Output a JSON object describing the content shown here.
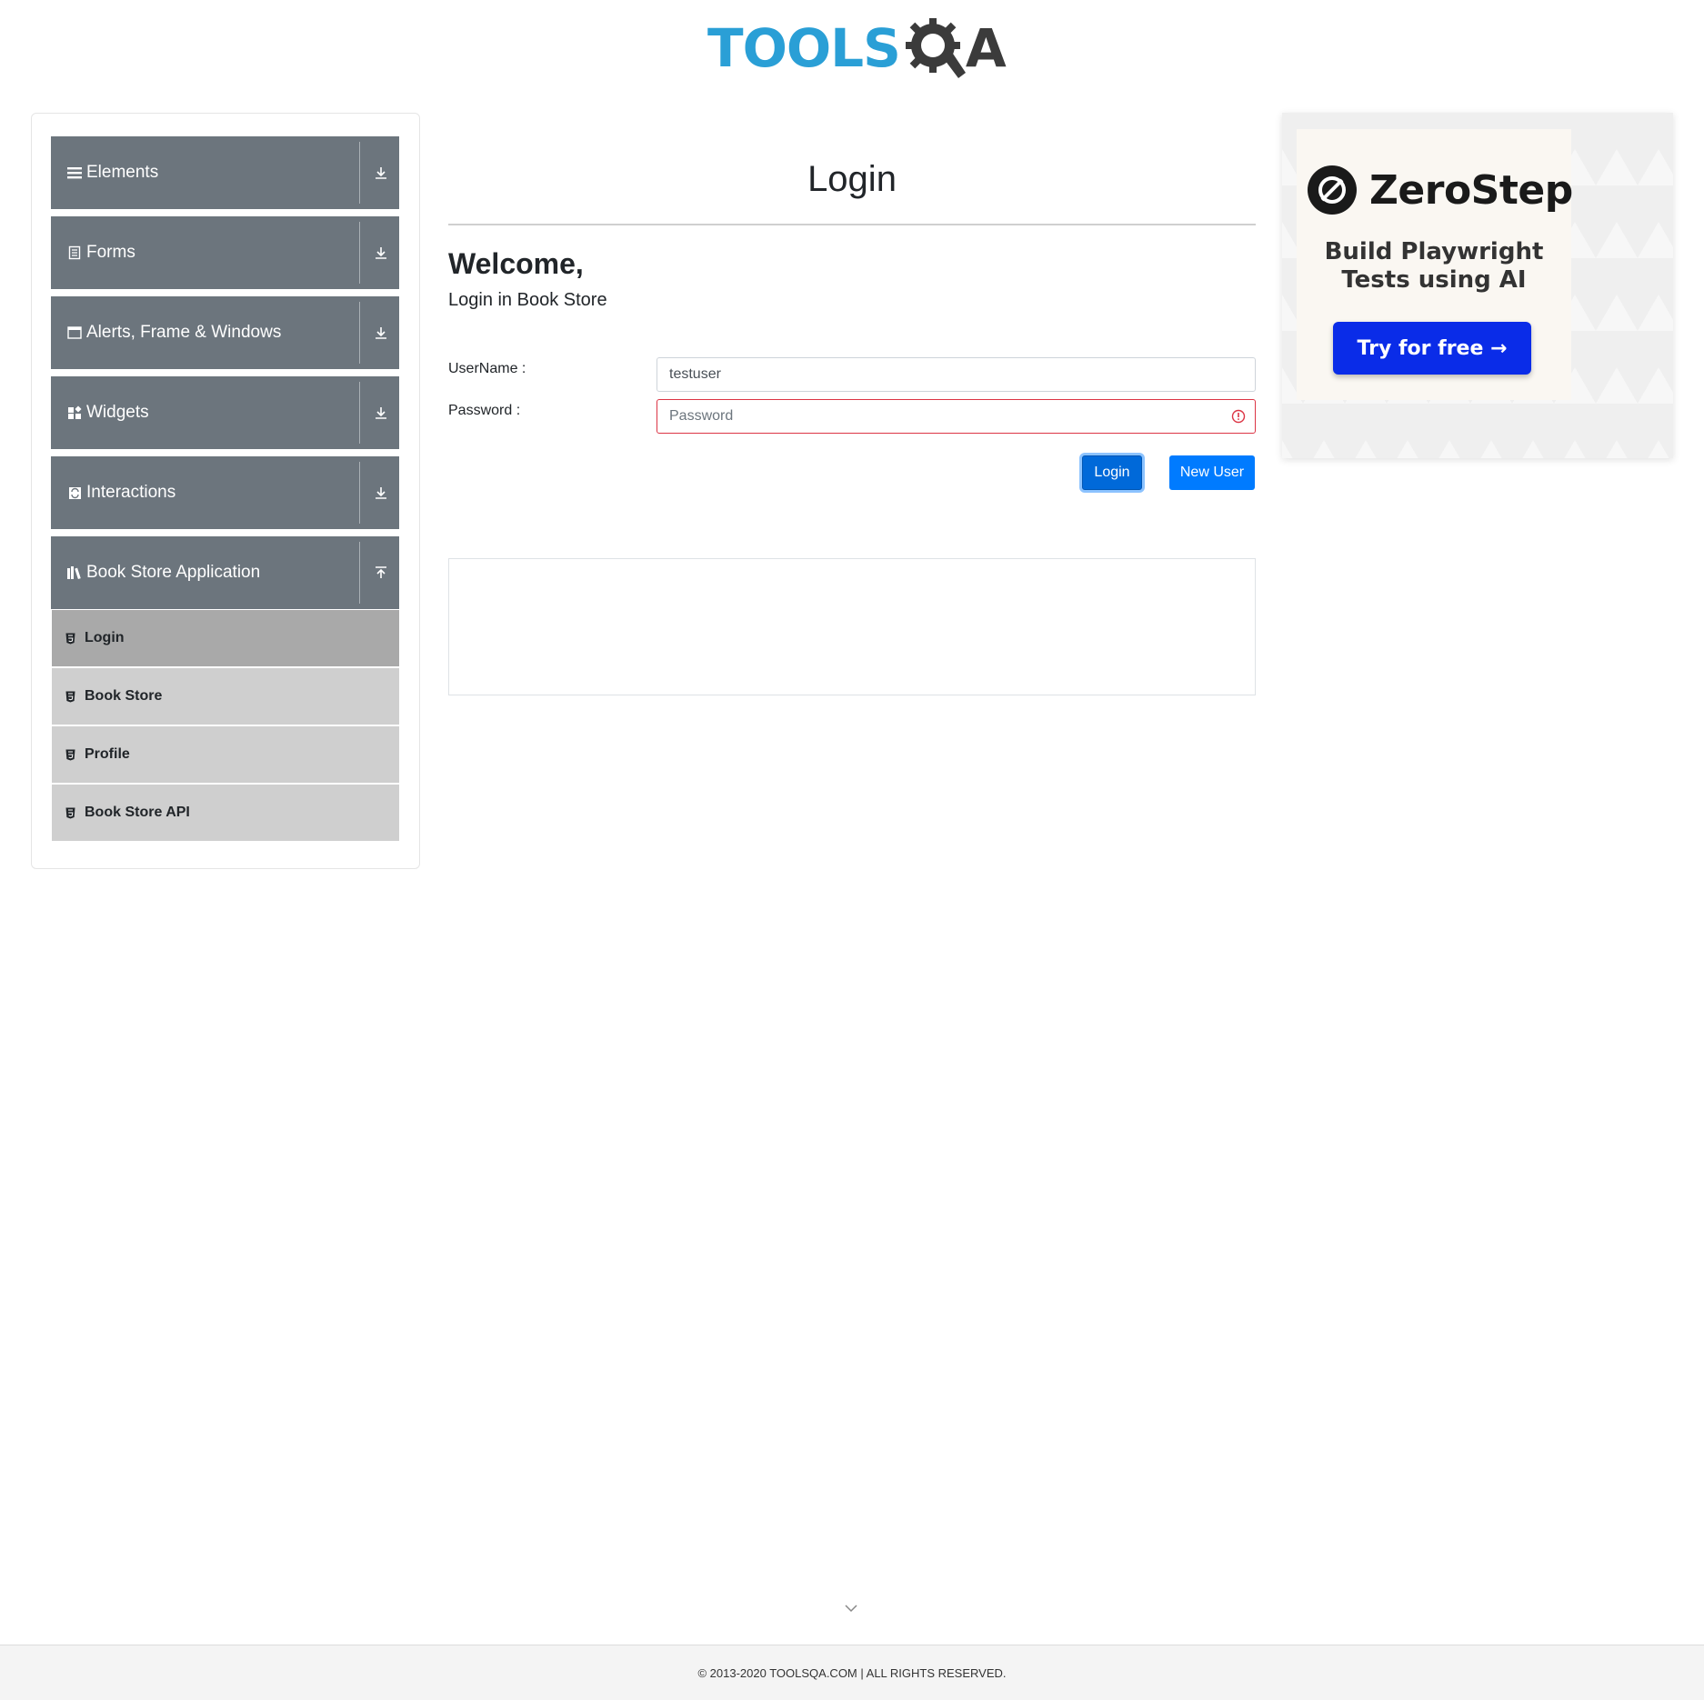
{
  "header": {
    "logo_text": "TOOLS",
    "logo_suffix": "A"
  },
  "sidebar": {
    "groups": [
      {
        "label": "Elements",
        "icon": "hamburger-icon",
        "expanded": false
      },
      {
        "label": "Forms",
        "icon": "document-icon",
        "expanded": false
      },
      {
        "label": "Alerts, Frame & Windows",
        "icon": "window-icon",
        "expanded": false
      },
      {
        "label": "Widgets",
        "icon": "widgets-icon",
        "expanded": false
      },
      {
        "label": "Interactions",
        "icon": "interactions-icon",
        "expanded": false
      },
      {
        "label": "Book Store Application",
        "icon": "books-icon",
        "expanded": true
      }
    ],
    "subitems": [
      {
        "label": "Login",
        "active": true
      },
      {
        "label": "Book Store",
        "active": false
      },
      {
        "label": "Profile",
        "active": false
      },
      {
        "label": "Book Store API",
        "active": false
      }
    ]
  },
  "main": {
    "title": "Login",
    "welcome": "Welcome,",
    "subtitle": "Login in Book Store",
    "username_label": "UserName :",
    "username_value": "testuser",
    "password_label": "Password :",
    "password_placeholder": "Password",
    "login_button": "Login",
    "new_user_button": "New User"
  },
  "ad": {
    "brand": "ZeroStep",
    "tagline_line1": "Build Playwright",
    "tagline_line2": "Tests using AI",
    "cta": "Try for free →"
  },
  "footer": {
    "text": "© 2013-2020 TOOLSQA.COM | ALL RIGHTS RESERVED."
  },
  "colors": {
    "primary": "#007bff",
    "sidebar_group": "#6c757d",
    "sidebar_sub": "#cfcfcf",
    "sidebar_sub_active": "#a9a9a9",
    "error": "#dc3545",
    "logo_blue": "#2a9fd6",
    "ad_cta": "#0a2ce8"
  }
}
